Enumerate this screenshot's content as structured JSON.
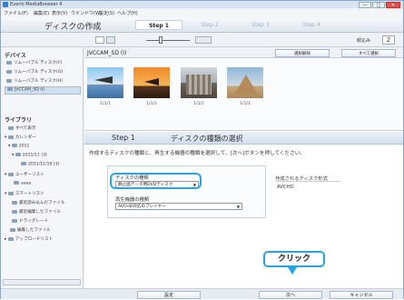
{
  "window": {
    "title": "Everio MediaBrowser 4",
    "controls": {
      "minimize": "—",
      "maximize": "□",
      "close": "✕"
    }
  },
  "menu": [
    "ファイル(F)",
    "編集(E)",
    "表示(V)",
    "ウインドウ(W)",
    "設定(S)",
    "ヘルプ(H)"
  ],
  "wizard": {
    "heading": "ディスクの作成",
    "steps": [
      "Step 1",
      "Step 2",
      "Step 3",
      "Step 4"
    ],
    "active_step": 0
  },
  "toolbar": {
    "filter_label": "絞込み",
    "sort_label": "Z"
  },
  "sidebar": {
    "devices_heading": "デバイス",
    "devices": [
      "リムーバブル ディスク(F)",
      "リムーバブル ディスク(G)",
      "リムーバブル ディスク(H)",
      "JVCCAM_SD (I)"
    ],
    "selected_device": 3,
    "library_heading": "ライブラリ",
    "library": [
      "すべて表示",
      "カレンダー",
      "2011",
      "2011/11 (3)",
      "2011/11/19 (3)",
      "ユーザーリスト",
      "aaaa",
      "スマートリスト",
      "最近読み込んだファイル",
      "最近編集したファイル",
      "ドラッグレート",
      "編集したファイル",
      "アップロードリスト"
    ]
  },
  "device": {
    "name": "JVCCAM_SD (I)",
    "deselect_label": "選択解除",
    "select_all_label": "すべて選択"
  },
  "thumbnails": [
    "1/1/1",
    "1/1/1",
    "1/1/1",
    "1/1/1"
  ],
  "step_panel": {
    "step": "Step 1",
    "title": "ディスクの種類の選択",
    "instruction": "作成するディスクの種類と、再生する機器の種類を選択して、[次へ]ボタンを押してください。",
    "disc_type_label": "ディスクの種類",
    "disc_type_value": "静止画データ用DVDディスク",
    "player_label": "再生機器の種類",
    "player_value": "AVCHD対応のプレイヤー",
    "format_label": "作成されるディスク形式",
    "format_value": "AVCHD"
  },
  "bottom": {
    "settings_label": "設定",
    "next_label": "次へ",
    "cancel_label": "キャンセル"
  },
  "callout": {
    "text": "クリック"
  },
  "colors": {
    "highlight": "#2aa4e0",
    "accent": "#3a7bd5"
  }
}
